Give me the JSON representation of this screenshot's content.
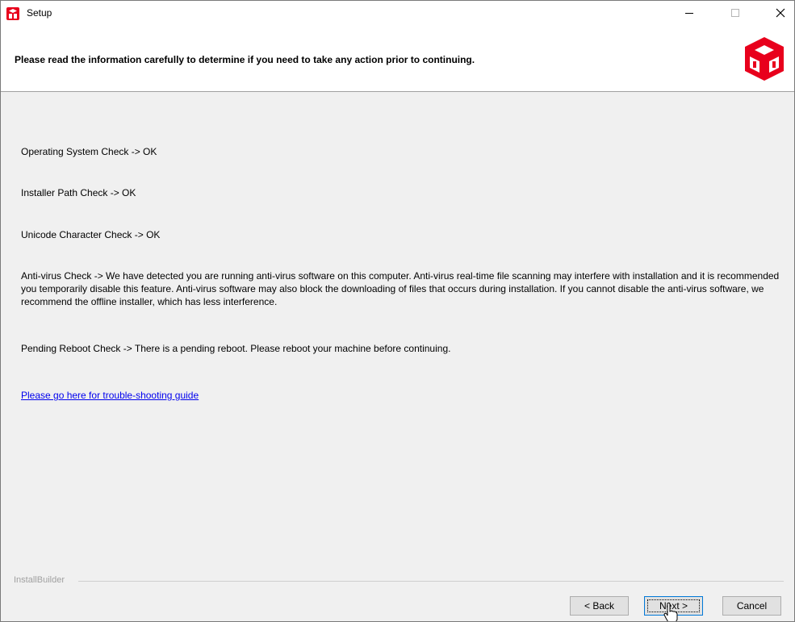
{
  "window": {
    "title": "Setup",
    "controls": {
      "minimize_icon": "minimize-icon",
      "maximize_icon": "maximize-icon",
      "close_icon": "close-icon"
    }
  },
  "header": {
    "instruction": "Please read the information carefully to determine if you need to take any action prior to continuing.",
    "logo_color": "#e8001c"
  },
  "checks": [
    {
      "text": "Operating System Check -> OK"
    },
    {
      "text": "Installer Path Check -> OK"
    },
    {
      "text": "Unicode Character Check ->  OK"
    },
    {
      "text": "Anti-virus Check -> We have detected you are running anti-virus software on this computer. Anti-virus real-time file scanning may interfere with installation and it is recommended you temporarily disable this feature. Anti-virus software may also block the downloading of files that occurs during installation. If you cannot disable the anti-virus software, we recommend the offline installer, which has less interference."
    },
    {
      "text": "Pending Reboot Check -> There is a pending reboot. Please reboot your machine before continuing."
    }
  ],
  "help_link": "Please go here for trouble-shooting guide",
  "footer": {
    "brand": "InstallBuilder",
    "back_label": "< Back",
    "next_label": "Next >",
    "cancel_label": "Cancel"
  },
  "colors": {
    "accent": "#0078d7",
    "link": "#0000ee",
    "brand_red": "#e8001c"
  }
}
